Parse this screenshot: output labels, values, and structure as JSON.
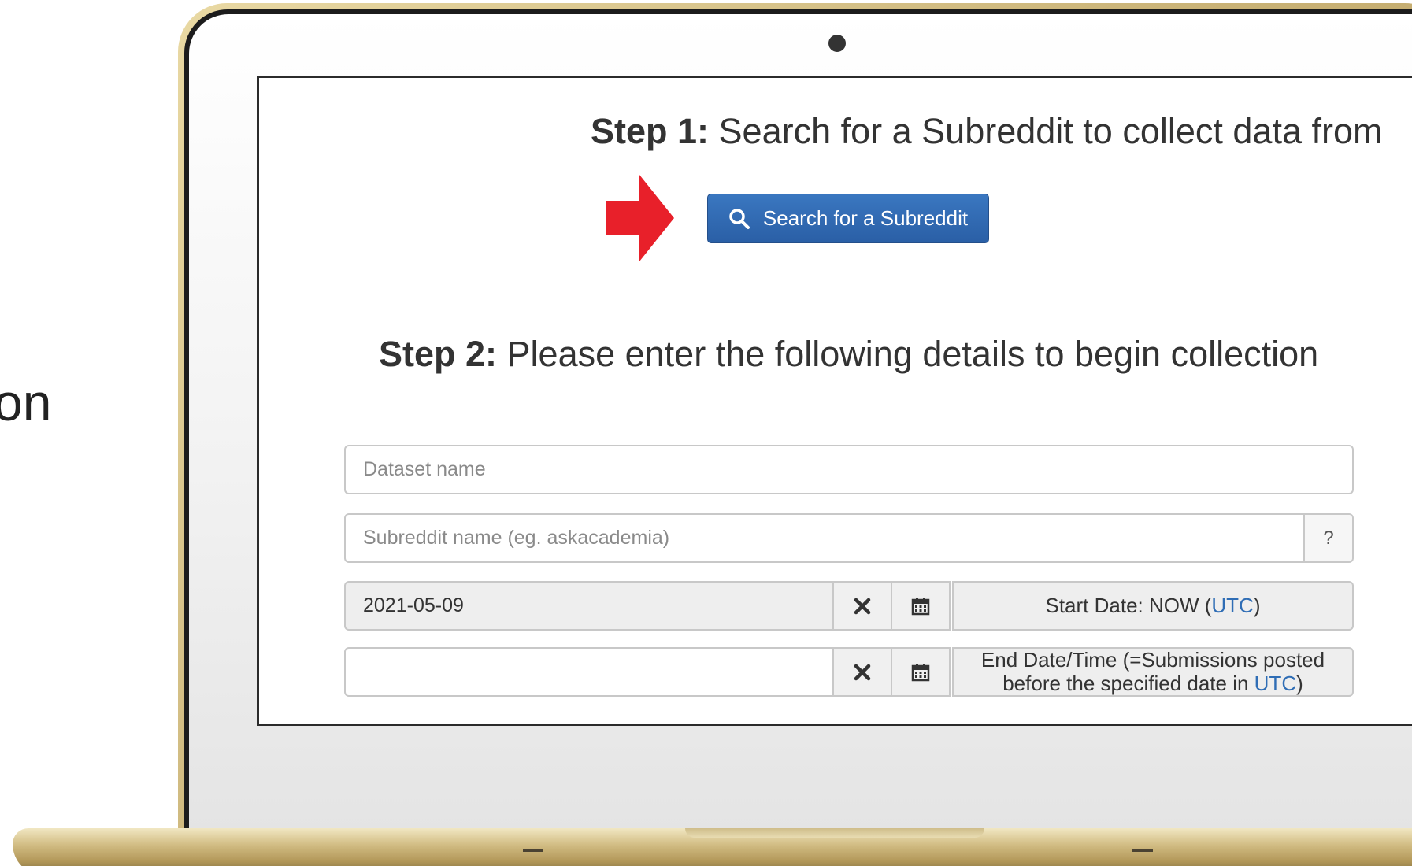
{
  "side_text": "on",
  "step1": {
    "bold": "Step 1:",
    "text": " Search for a Subreddit to collect data from"
  },
  "search_button": {
    "label": "Search for a Subreddit",
    "icon": "search-icon"
  },
  "step2": {
    "bold": "Step 2:",
    "text": " Please enter the following details to begin collection"
  },
  "form": {
    "dataset_name": {
      "value": "",
      "placeholder": "Dataset name"
    },
    "subreddit_name": {
      "value": "",
      "placeholder": "Subreddit name (eg. askacademia)",
      "help_label": "?"
    },
    "start_date": {
      "value": "2021-05-09",
      "label_prefix": "Start Date: NOW (",
      "label_link": "UTC",
      "label_suffix": ")"
    },
    "end_date": {
      "value": "",
      "label_line1": "End Date/Time (=Submissions posted",
      "label_line2_prefix": "before the specified date in ",
      "label_link": "UTC",
      "label_suffix": ")"
    }
  },
  "colors": {
    "button_blue": "#2a5fa6",
    "arrow_red": "#e8202a",
    "link_blue": "#2f6db5",
    "laptop_gold": "#c9b276"
  }
}
